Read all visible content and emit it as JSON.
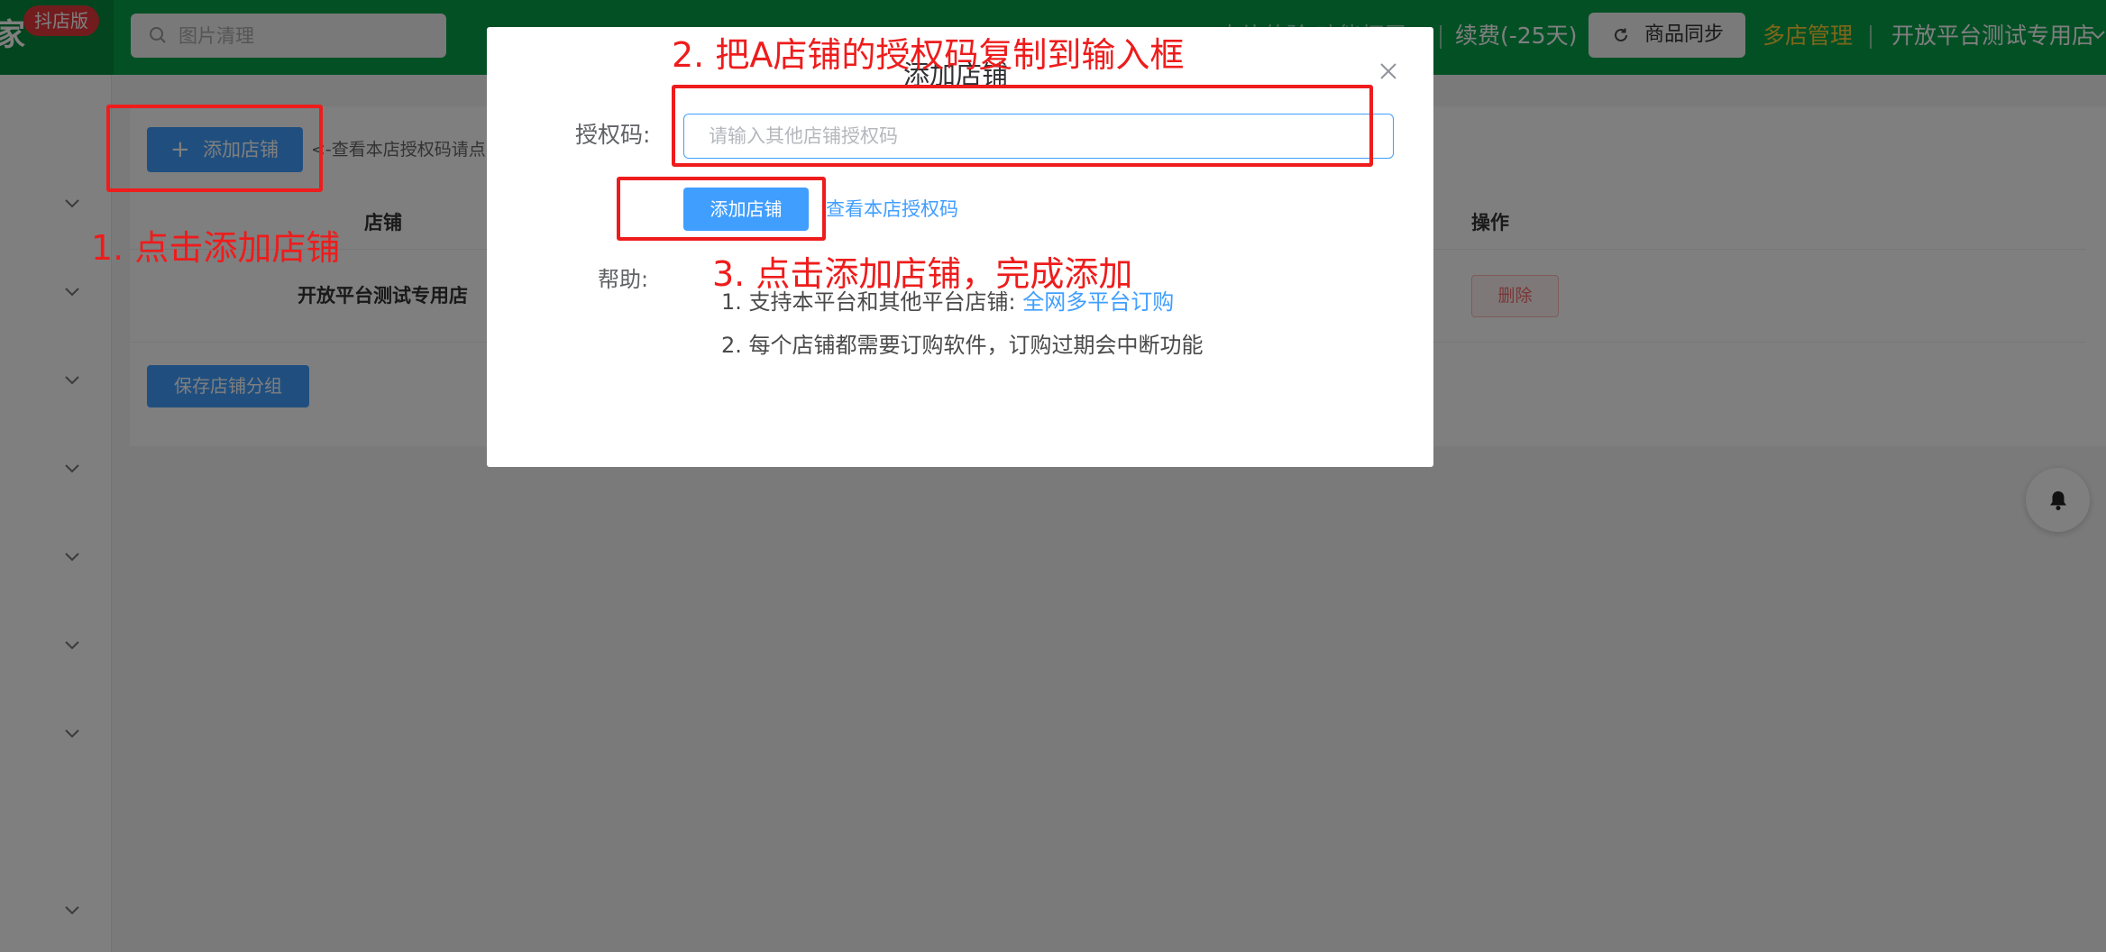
{
  "topbar": {
    "brand_char": "家",
    "badge": "抖店版",
    "search_placeholder": "图片清理",
    "faded_links": "卡片体验   功能拓展",
    "renew": "续费(-25天)",
    "sync_button": "商品同步",
    "multi_shop": "多店管理",
    "current_shop": "开放平台测试专用店",
    "colors": {
      "bar": "#07a14a",
      "badge": "#e4393c",
      "multi_shop": "#ffcc33"
    }
  },
  "page": {
    "add_shop_button": "添加店铺",
    "hint": "<-查看本店授权码请点",
    "table": {
      "headers": {
        "shop": "店铺",
        "action": "操作"
      },
      "rows": [
        {
          "shop": "开放平台测试专用店",
          "delete": "删除"
        }
      ]
    },
    "save_group_button": "保存店铺分组"
  },
  "dialog": {
    "title": "添加店铺",
    "auth_label": "授权码:",
    "auth_placeholder": "请输入其他店铺授权码",
    "add_button": "添加店铺",
    "view_code_link": "查看本店授权码",
    "help_label": "帮助:",
    "help_1_text": "1. 支持本平台和其他平台店铺:",
    "help_1_link": "全网多平台订购",
    "help_2": "2. 每个店铺都需要订购软件，订购过期会中断功能"
  },
  "annotations": {
    "step1": "1. 点击添加店铺",
    "step2": "2. 把A店铺的授权码复制到输入框",
    "step3": "3. 点击添加店铺，完成添加",
    "color": "#ee1c1c"
  }
}
